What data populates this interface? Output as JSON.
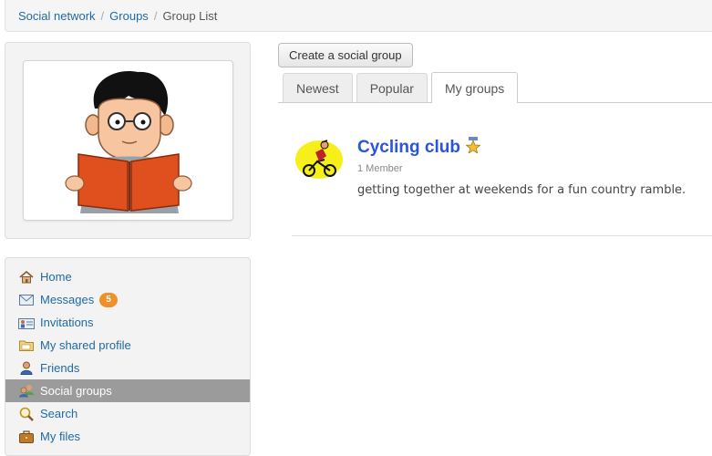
{
  "breadcrumb": {
    "items": [
      "Social network",
      "Groups"
    ],
    "current": "Group List",
    "separator": "/"
  },
  "profile": {
    "avatar_icon": "reading-person-avatar"
  },
  "menu": {
    "items": [
      {
        "label": "Home",
        "icon": "home-icon"
      },
      {
        "label": "Messages",
        "icon": "envelope-icon",
        "badge": "5"
      },
      {
        "label": "Invitations",
        "icon": "invitation-icon"
      },
      {
        "label": "My shared profile",
        "icon": "folder-icon"
      },
      {
        "label": "Friends",
        "icon": "friend-icon"
      },
      {
        "label": "Social groups",
        "icon": "group-icon",
        "active": true
      },
      {
        "label": "Search",
        "icon": "magnifier-icon"
      },
      {
        "label": "My files",
        "icon": "briefcase-icon"
      }
    ]
  },
  "actions": {
    "create_label": "Create a social group"
  },
  "tabs": [
    {
      "label": "Newest"
    },
    {
      "label": "Popular"
    },
    {
      "label": "My groups",
      "active": true
    }
  ],
  "groups": [
    {
      "title": "Cycling club",
      "members": "1 Member",
      "description": "getting together at weekends for a fun country ramble.",
      "logo_icon": "cyclist-icon",
      "badge_icon": "admin-star-icon"
    }
  ],
  "colors": {
    "link": "#1e6aa5",
    "active_menu": "#9b9b9b",
    "badge": "#f0902a",
    "group_title": "#2a52e3"
  }
}
